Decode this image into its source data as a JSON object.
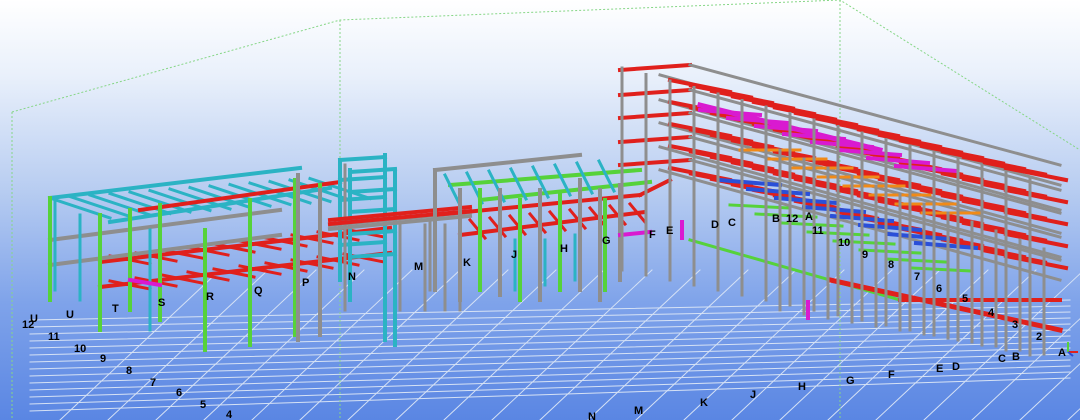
{
  "colors": {
    "beam_red": "#e0201c",
    "beam_cyan": "#2bb3c4",
    "beam_green": "#56d23a",
    "beam_magenta": "#d91ad0",
    "beam_gray": "#8e8e8e",
    "beam_blue": "#2a4fd8",
    "beam_orange": "#f08a18",
    "beam_yellow": "#e8d21a",
    "grid_line": "#d6e2f5",
    "bbox_line": "#7ad87a"
  },
  "grid_labels_numbers": [
    "12",
    "11",
    "10",
    "9",
    "8",
    "7",
    "6",
    "5",
    "4"
  ],
  "grid_labels_letters_front": [
    "N",
    "M",
    "K",
    "J",
    "H",
    "G",
    "F",
    "E",
    "D",
    "C",
    "B",
    "A"
  ],
  "grid_labels_right_numbers": [
    "2",
    "3",
    "4",
    "5",
    "6",
    "7",
    "8",
    "9",
    "10",
    "11",
    "12"
  ],
  "structure_labels_left": [
    "U",
    "T",
    "S",
    "R",
    "Q",
    "P",
    "N",
    "M",
    "K",
    "J",
    "H",
    "G",
    "F",
    "E",
    "D",
    "C",
    "B",
    "A"
  ],
  "marker_icons": [
    "axis-gizmo-icon"
  ]
}
